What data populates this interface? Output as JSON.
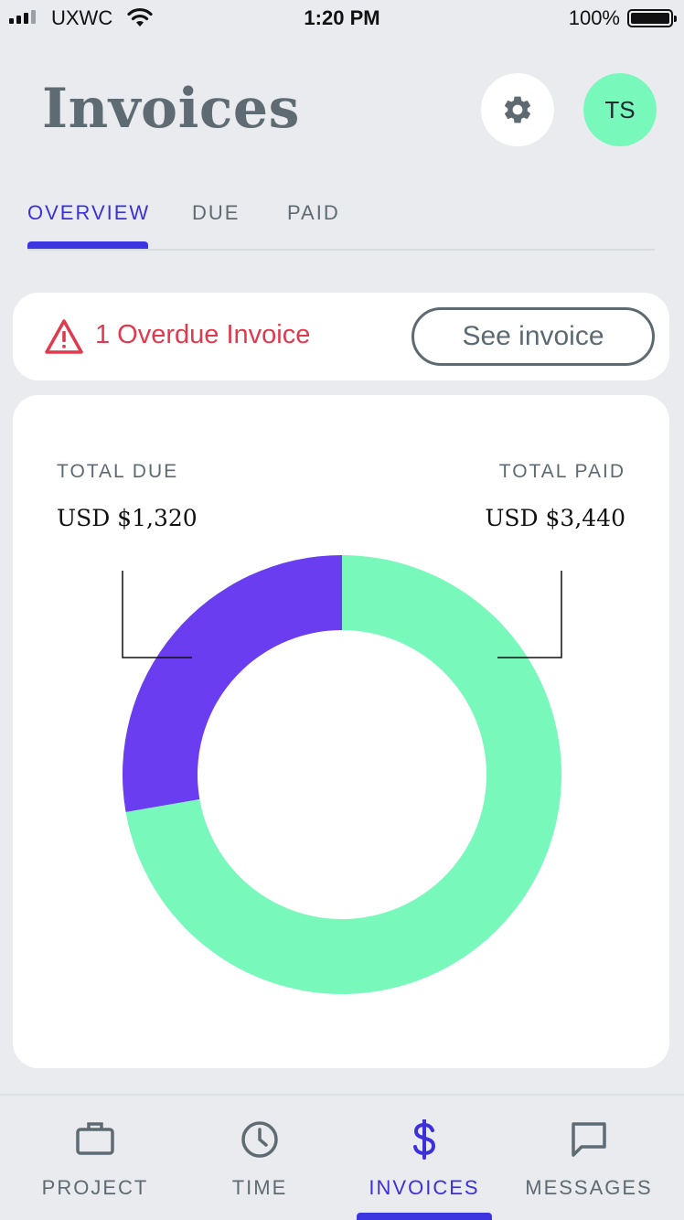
{
  "status_bar": {
    "carrier": "UXWC",
    "time": "1:20 PM",
    "battery": "100%"
  },
  "header": {
    "title": "Invoices",
    "avatar_initials": "TS",
    "avatar_color": "#78f9bb"
  },
  "tabs": [
    {
      "label": "OVERVIEW",
      "active": true
    },
    {
      "label": "DUE",
      "active": false
    },
    {
      "label": "PAID",
      "active": false
    }
  ],
  "alert": {
    "icon": "warning-icon",
    "text": "1 Overdue Invoice",
    "button_label": "See invoice",
    "color": "#e03a4e"
  },
  "summary": {
    "total_due_label": "TOTAL DUE",
    "total_due_value": "USD $1,320",
    "total_paid_label": "TOTAL PAID",
    "total_paid_value": "USD $3,440"
  },
  "chart_data": {
    "type": "pie",
    "style": "donut",
    "categories": [
      "TOTAL DUE",
      "TOTAL PAID"
    ],
    "values": [
      1320,
      3440
    ],
    "colors": [
      "#6a3df0",
      "#78f9bb"
    ],
    "legend": "labels at top-left and top-right with leader lines"
  },
  "bottom_nav": [
    {
      "label": "PROJECT",
      "icon": "briefcase-icon",
      "active": false
    },
    {
      "label": "TIME",
      "icon": "clock-icon",
      "active": false
    },
    {
      "label": "INVOICES",
      "icon": "dollar-icon",
      "active": true
    },
    {
      "label": "MESSAGES",
      "icon": "message-icon",
      "active": false
    }
  ],
  "colors": {
    "accent": "#3d36e0",
    "background": "#e9ebee"
  }
}
